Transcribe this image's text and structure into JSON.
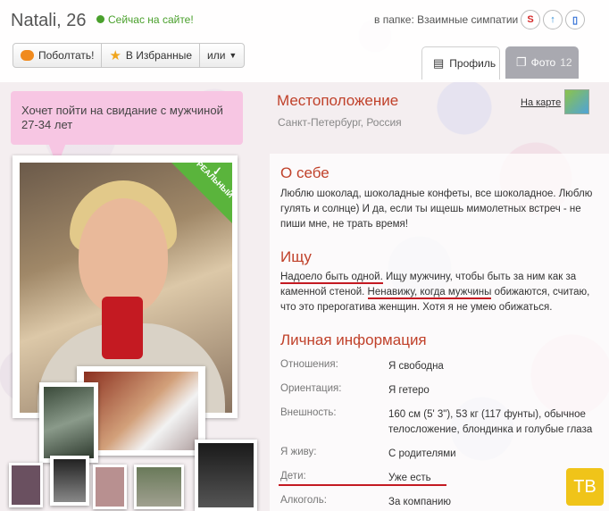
{
  "header": {
    "name": "Natali, 26",
    "online": "Сейчас на сайте!",
    "folder": "в папке: Взаимные симпатии"
  },
  "buttons": {
    "chat": "Поболтать!",
    "favorites": "В Избранные",
    "more": "или"
  },
  "tabs": {
    "profile": "Профиль",
    "photo": "Фото",
    "photo_count": "12"
  },
  "bubble": "Хочет пойти на свидание с мужчиной 27-34 лет",
  "photo_badge": "РЕАЛЬНЫЙ",
  "location": {
    "title": "Местоположение",
    "value": "Санкт-Петербург, Россия",
    "map_link": "На карте"
  },
  "about": {
    "title": "О себе",
    "text": "Люблю шоколад, шоколадные конфеты, все шоколадное. Люблю гулять и солнце) И да, если ты ищешь мимолетных встреч - не пиши мне, не трать время!"
  },
  "seek": {
    "title": "Ищу",
    "p1": "Надоело быть одной.",
    "p2": " Ищу мужчину, чтобы быть за ним как за каменной стеной. ",
    "p3": "Ненавижу, когда мужчины",
    "p4": " обижаются, считаю, что это прерогатива женщин. Хотя я не умею обижаться."
  },
  "info": {
    "title": "Личная информация",
    "rows": [
      {
        "label": "Отношения:",
        "value": "Я свободна"
      },
      {
        "label": "Ориентация:",
        "value": "Я гетеро"
      },
      {
        "label": "Внешность:",
        "value": "160 см (5' 3\"), 53 кг (117 фунты), обычное телосложение, блондинка и голубые глаза"
      },
      {
        "label": "Я живу:",
        "value": "С родителями"
      },
      {
        "label": "Дети:",
        "value": "Уже есть"
      },
      {
        "label": "Алкоголь:",
        "value": "За компанию"
      }
    ]
  },
  "watermark": "ТВ",
  "colors": {
    "accent": "#c0412a",
    "online": "#4aa02c",
    "bubble": "#f7c6e3",
    "badge": "#5ab43c"
  }
}
